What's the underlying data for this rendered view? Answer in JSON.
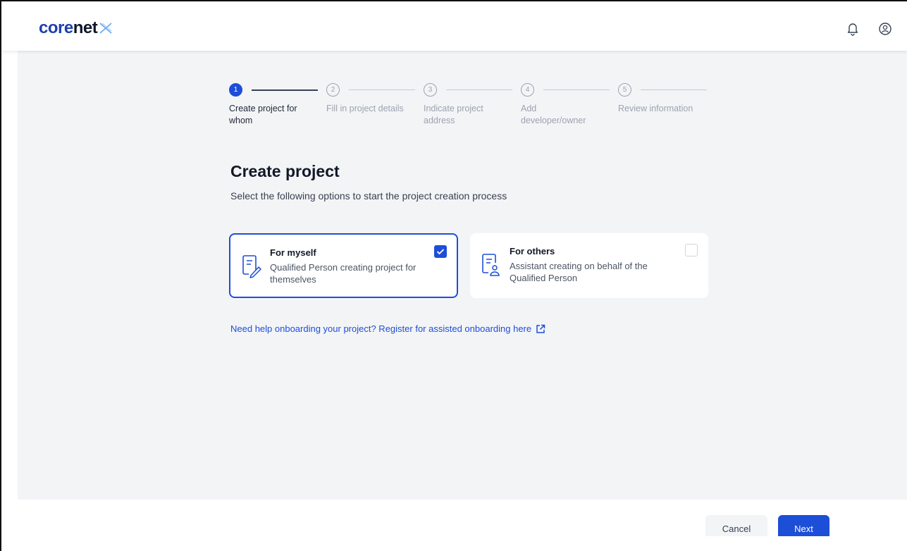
{
  "app": {
    "logo_core": "core",
    "logo_net": "net",
    "brand_color": "#1d4ed8"
  },
  "header": {
    "icons": [
      "bell-icon",
      "user-profile-icon"
    ]
  },
  "stepper": {
    "steps": [
      {
        "number": "1",
        "label": "Create project for whom",
        "active": true
      },
      {
        "number": "2",
        "label": "Fill in project details",
        "active": false
      },
      {
        "number": "3",
        "label": "Indicate project address",
        "active": false
      },
      {
        "number": "4",
        "label": "Add developer/owner",
        "active": false
      },
      {
        "number": "5",
        "label": "Review information",
        "active": false
      }
    ]
  },
  "main": {
    "title": "Create project",
    "subtitle": "Select the following options to start the project creation process",
    "options": [
      {
        "title": "For myself",
        "description": "Qualified Person creating project for themselves",
        "selected": true,
        "icon": "document-edit-icon"
      },
      {
        "title": "For others",
        "description": "Assistant creating on behalf of the Qualified Person",
        "selected": false,
        "icon": "document-person-icon"
      }
    ],
    "help_link": "Need help onboarding your project? Register for assisted onboarding here"
  },
  "footer": {
    "cancel_label": "Cancel",
    "next_label": "Next"
  }
}
